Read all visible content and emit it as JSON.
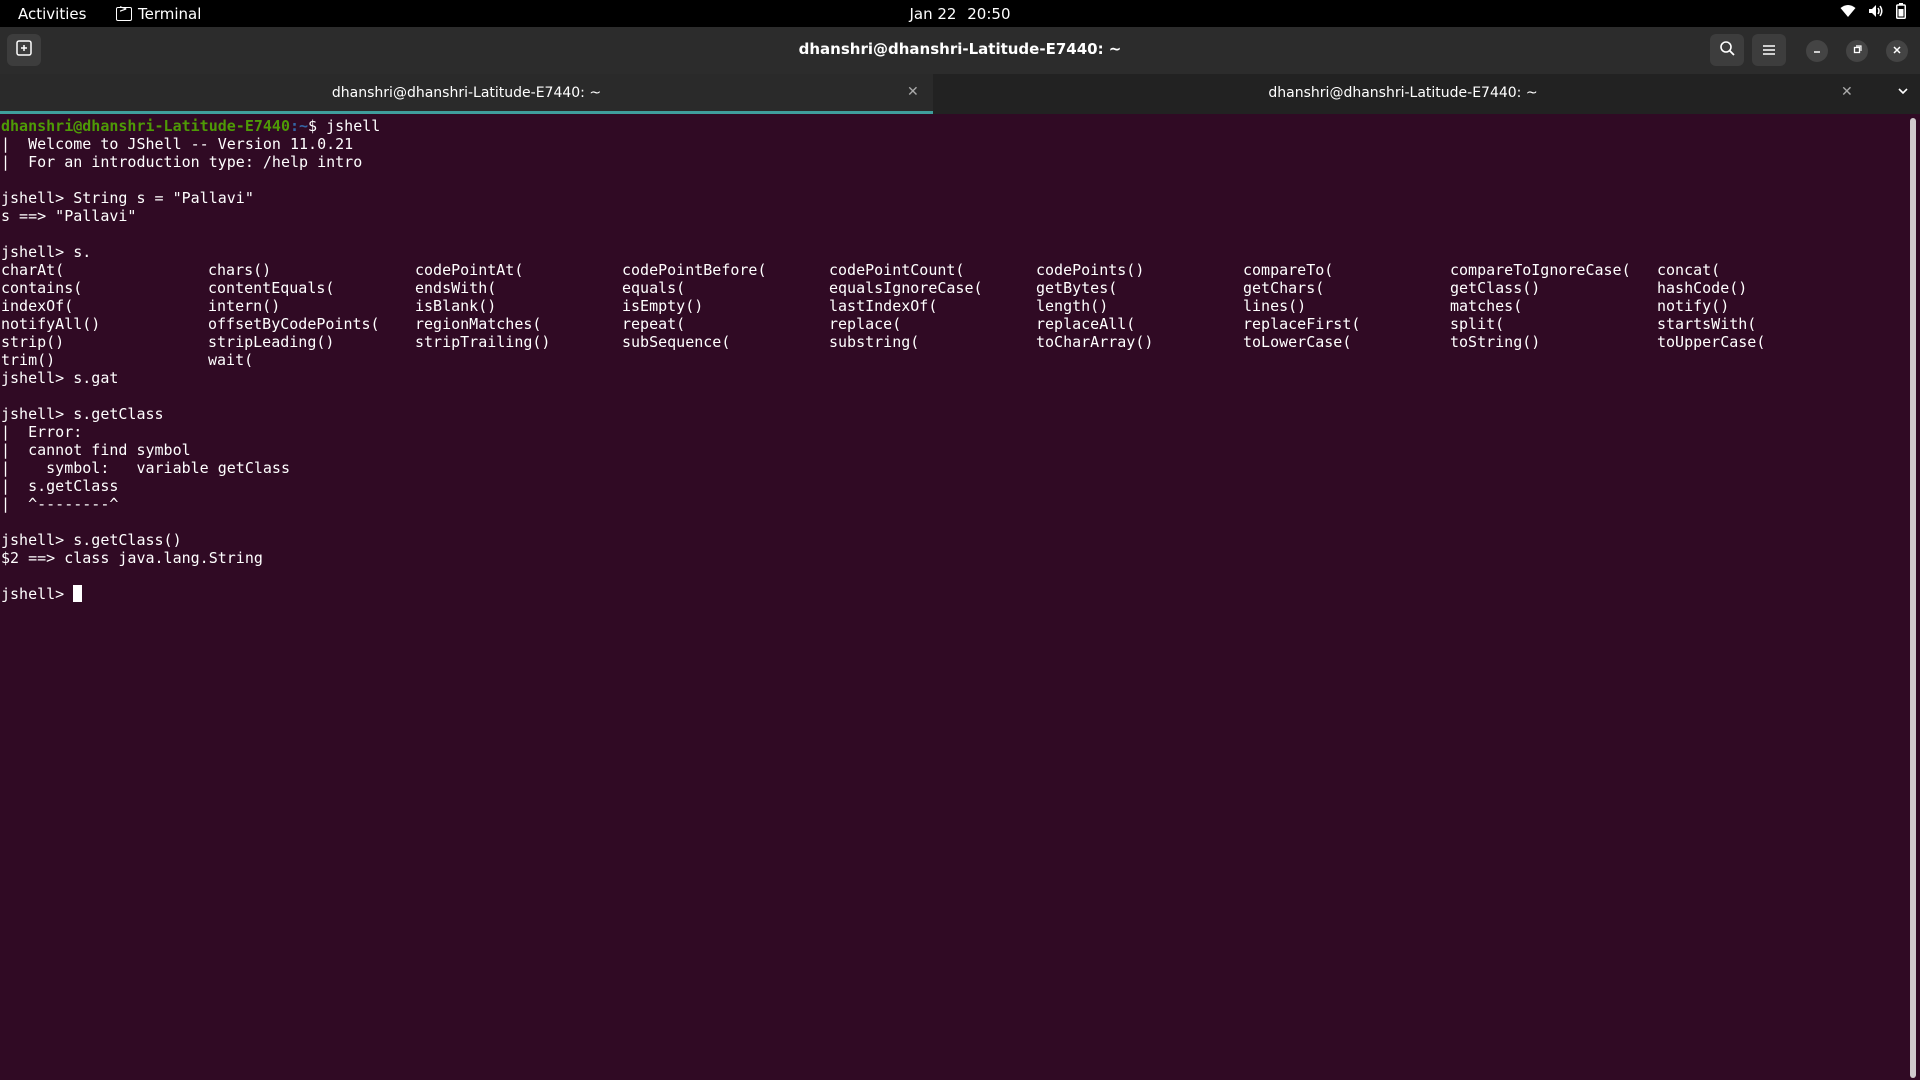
{
  "topbar": {
    "activities": "Activities",
    "app_name": "Terminal",
    "date": "Jan 22",
    "time": "20:50",
    "icons": [
      "wifi-icon",
      "volume-icon",
      "battery-icon"
    ]
  },
  "window": {
    "title": "dhanshri@dhanshri-Latitude-E7440: ~"
  },
  "tabs": [
    {
      "label": "dhanshri@dhanshri-Latitude-E7440: ~",
      "active": true
    },
    {
      "label": "dhanshri@dhanshri-Latitude-E7440: ~",
      "active": false
    }
  ],
  "terminal": {
    "prompt_user": "dhanshri@dhanshri-Latitude-E7440",
    "prompt_path": ":~",
    "prompt_cmd": "$ jshell",
    "lines": [
      "|  Welcome to JShell -- Version 11.0.21",
      "|  For an introduction type: /help intro",
      "",
      "jshell> String s = \"Pallavi\"",
      "s ==> \"Pallavi\"",
      "",
      "jshell> s."
    ],
    "completions": [
      [
        "charAt(",
        "chars()",
        "codePointAt(",
        "codePointBefore(",
        "codePointCount(",
        "codePoints()",
        "compareTo(",
        "compareToIgnoreCase(",
        "concat("
      ],
      [
        "contains(",
        "contentEquals(",
        "endsWith(",
        "equals(",
        "equalsIgnoreCase(",
        "getBytes(",
        "getChars(",
        "getClass()",
        "hashCode()"
      ],
      [
        "indexOf(",
        "intern()",
        "isBlank()",
        "isEmpty()",
        "lastIndexOf(",
        "length()",
        "lines()",
        "matches(",
        "notify()"
      ],
      [
        "notifyAll()",
        "offsetByCodePoints(",
        "regionMatches(",
        "repeat(",
        "replace(",
        "replaceAll(",
        "replaceFirst(",
        "split(",
        "startsWith("
      ],
      [
        "strip()",
        "stripLeading()",
        "stripTrailing()",
        "subSequence(",
        "substring(",
        "toCharArray()",
        "toLowerCase(",
        "toString()",
        "toUpperCase("
      ],
      [
        "trim()",
        "wait("
      ]
    ],
    "lines_after": [
      "jshell> s.gat",
      "",
      "jshell> s.getClass",
      "|  Error:",
      "|  cannot find symbol",
      "|    symbol:   variable getClass",
      "|  s.getClass",
      "|  ^--------^",
      "",
      "jshell> s.getClass()",
      "$2 ==> class java.lang.String",
      ""
    ],
    "final_prompt": "jshell> "
  }
}
